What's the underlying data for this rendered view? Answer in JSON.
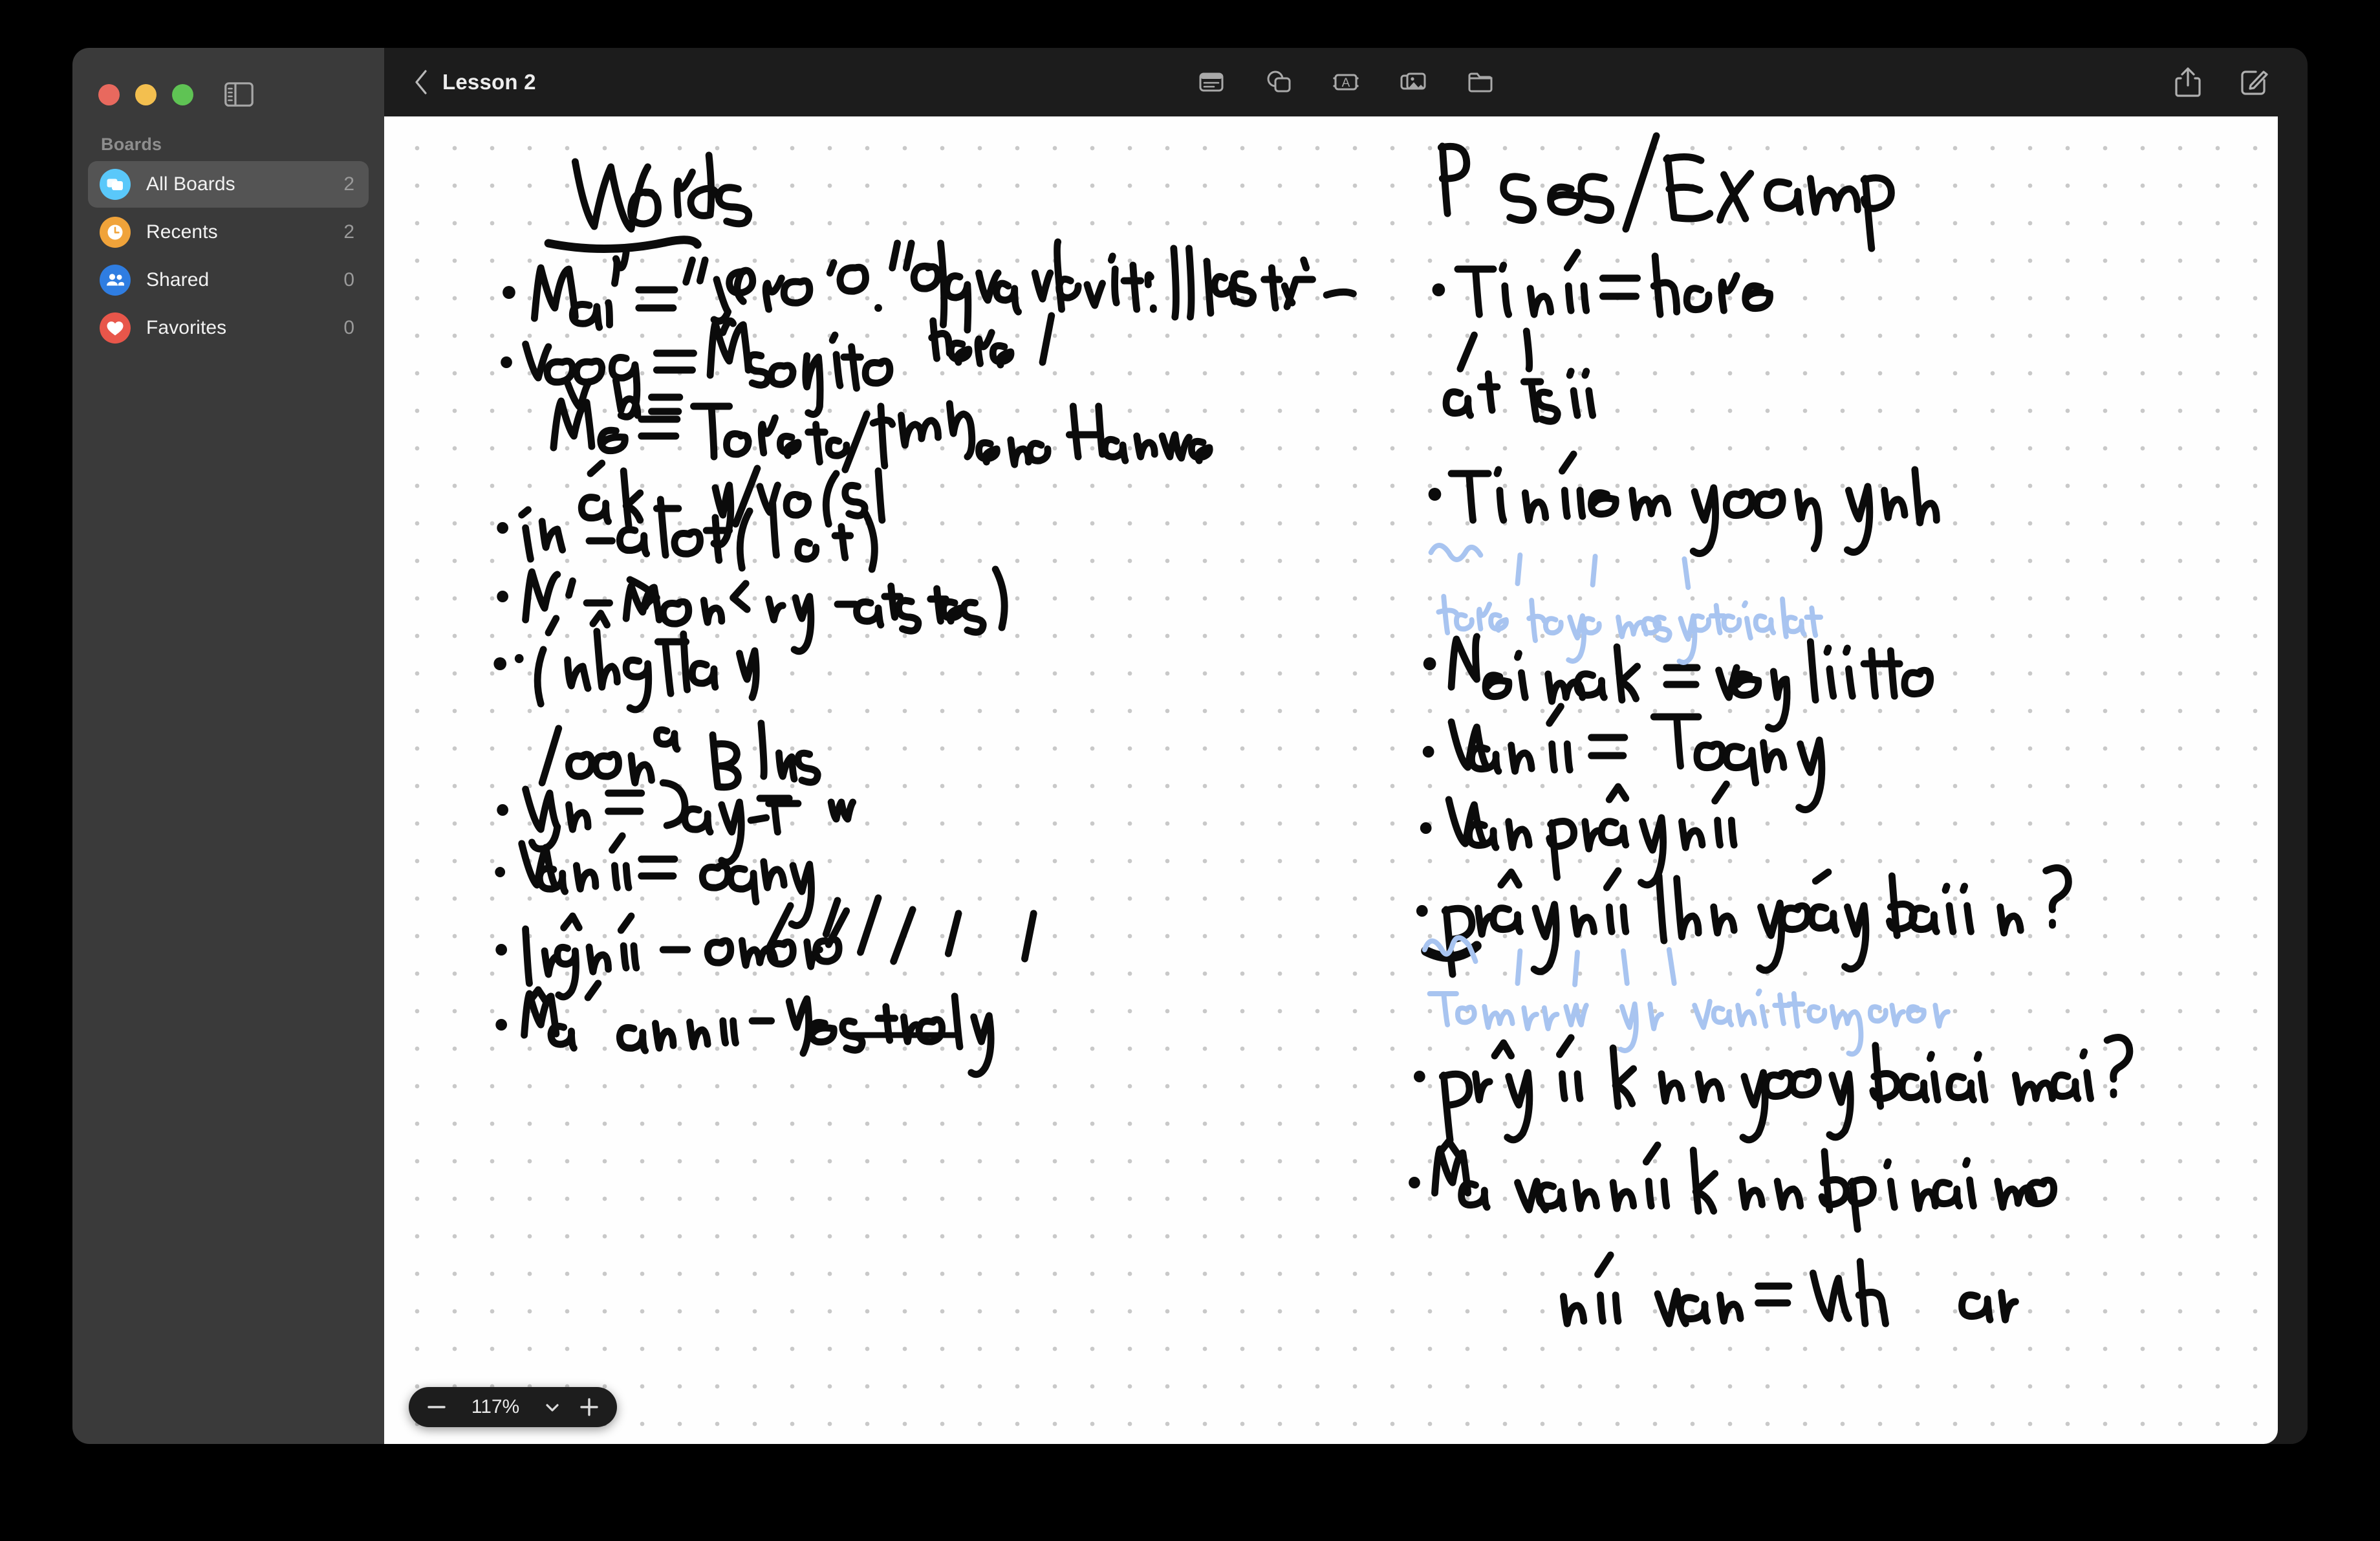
{
  "window": {
    "traffic_lights": [
      {
        "name": "close",
        "color": "#e8695e"
      },
      {
        "name": "minimize",
        "color": "#f3bf4f"
      },
      {
        "name": "maximize",
        "color": "#5fc354"
      }
    ],
    "sidebar_toggle_icon": "sidebar-toggle-icon"
  },
  "sidebar": {
    "section_label": "Boards",
    "items": [
      {
        "label": "All Boards",
        "count": "2",
        "icon": "boards-stack-icon",
        "icon_color": "#5ac8fa",
        "selected": true
      },
      {
        "label": "Recents",
        "count": "2",
        "icon": "clock-icon",
        "icon_color": "#f0a33a",
        "selected": false
      },
      {
        "label": "Shared",
        "count": "0",
        "icon": "people-icon",
        "icon_color": "#2f7de1",
        "selected": false
      },
      {
        "label": "Favorites",
        "count": "0",
        "icon": "heart-icon",
        "icon_color": "#e8564a",
        "selected": false
      }
    ]
  },
  "toolbar": {
    "back_icon": "chevron-left-icon",
    "title": "Lesson 2",
    "center_tools": [
      {
        "name": "sticky-note-icon",
        "label": "Note"
      },
      {
        "name": "shapes-icon",
        "label": "Shapes"
      },
      {
        "name": "text-box-icon",
        "label": "Text"
      },
      {
        "name": "media-icon",
        "label": "Media"
      },
      {
        "name": "folder-icon",
        "label": "Files"
      }
    ],
    "right_tools": [
      {
        "name": "share-icon",
        "label": "Share"
      },
      {
        "name": "compose-icon",
        "label": "Markup"
      }
    ]
  },
  "zoom_control": {
    "minus_label": "−",
    "value": "117%",
    "chevron_icon": "chevron-down-icon",
    "plus_label": "+"
  },
  "canvas": {
    "ink_color": "#0b0b0b",
    "annotation_color": "#a8c4f0",
    "dot_color": "#c9c9c9",
    "background": "#fefefe",
    "columns": [
      {
        "name": "words-column",
        "heading": "Words",
        "heading_underlined": true,
        "lines": [
          "Mai n = \"Y g or ' o.\" do you isn't I / has it i-",
          "Yoo g = M squito        here    /",
          "Me = T ere 's / am un   are  Have",
          "ak -        y/ve      (sl",
          "1u  - a lot (  o  t)",
          "M   - man  < ry   -atus)",
          "(uh g Thal y",
          "loon a    Blus",
          "W n = Day  T        w",
          "Wan ii =  oday",
          "Truing nii  -   omorro",
          "Mua  an nii - Yesterday"
        ]
      },
      {
        "name": "phrases-column",
        "heading": "P   ses/Examp",
        "heading_underlined": false,
        "lines": [
          "Ti nii = here",
          "at   this",
          "Ti nii me yoong yuh",
          "Noi mak = very little",
          "Wan nii = Today",
          "Wan prûng nii",
          "Prûng nii lhun yàag boai n ?",
          "Pr^g ii k un yaag b ai ai mai?",
          "Mûa wan nii khun bp i nai ma",
          "nii wan = Wh      ar"
        ],
        "annotations": [
          "Here  have  mosquito  a lot",
          "Tom rrow   y u  want  to go  w ere"
        ]
      }
    ]
  }
}
